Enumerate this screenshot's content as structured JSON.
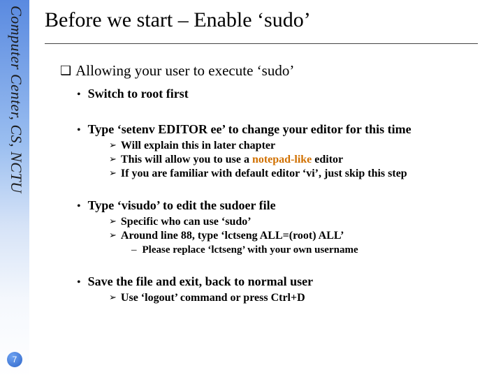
{
  "sidebar": {
    "label": "Computer Center, CS, NCTU"
  },
  "slide": {
    "number": "7"
  },
  "title": "Before we start – Enable ‘sudo’",
  "l1": {
    "text": "Allowing your user to execute ‘sudo’"
  },
  "b1": {
    "text": "Switch to root first"
  },
  "b2": {
    "text": "Type ‘setenv EDITOR ee’ to change your editor for this time",
    "s1": "Will explain this in later chapter",
    "s2a": "This will allow you to use a ",
    "s2b": "notepad-like",
    "s2c": " editor",
    "s3": "If you are familiar with default editor ‘vi’, just skip this step"
  },
  "b3": {
    "text": "Type ‘visudo’ to edit the sudoer file",
    "s1": "Specific who can use ‘sudo’",
    "s2": "Around line 88, type ‘lctseng ALL=(root) ALL’",
    "s2a": "Please replace ‘lctseng’ with your own username"
  },
  "b4": {
    "text": "Save the file and exit, back to normal user",
    "s1": "Use ‘logout’ command or press Ctrl+D"
  }
}
